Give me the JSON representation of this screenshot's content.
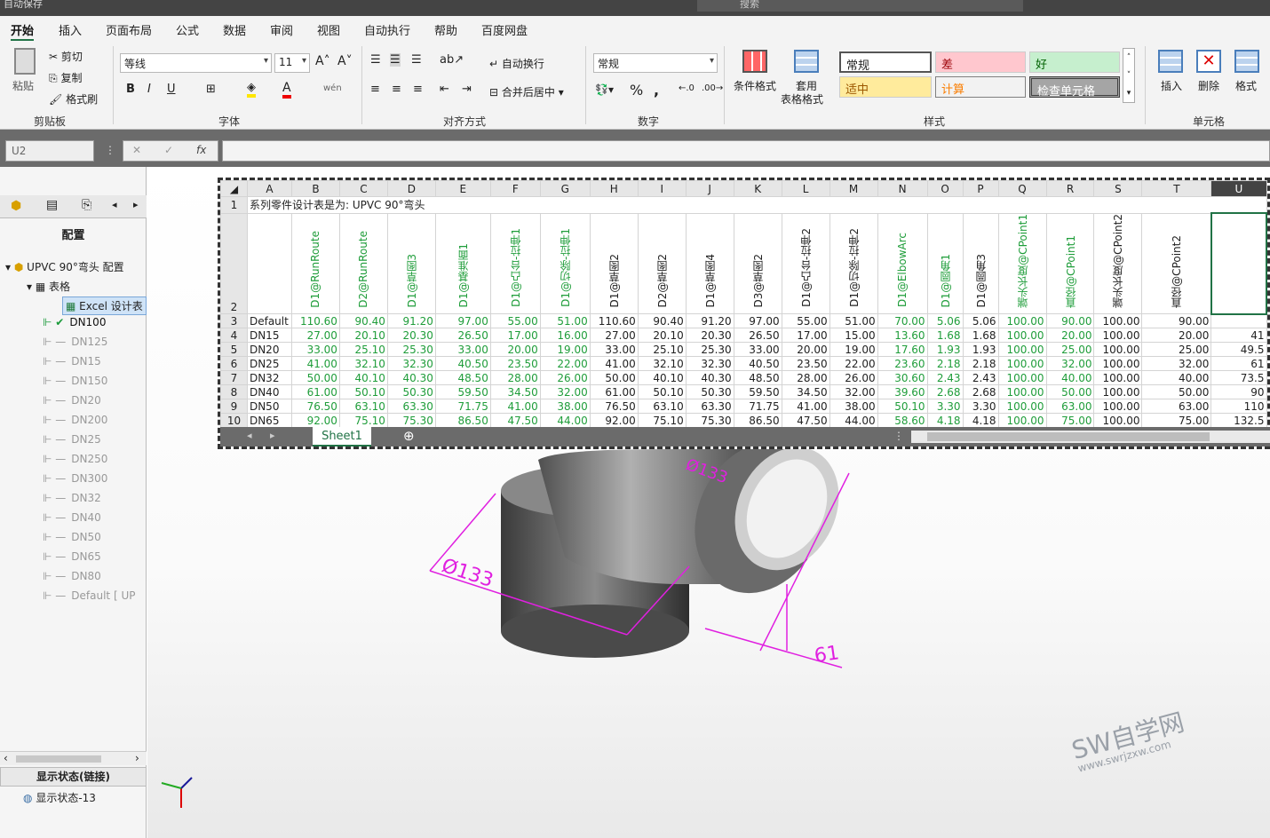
{
  "topbar": {
    "autosave": "自动保存",
    "search": "搜索"
  },
  "tabs": [
    "开始",
    "插入",
    "页面布局",
    "公式",
    "数据",
    "审阅",
    "视图",
    "自动执行",
    "帮助",
    "百度网盘"
  ],
  "ribbon": {
    "clipboard": {
      "paste": "粘贴",
      "cut": "剪切",
      "copy": "复制",
      "format_painter": "格式刷",
      "label": "剪贴板"
    },
    "font": {
      "name": "等线",
      "size": "11",
      "label": "字体"
    },
    "align": {
      "wrap": "自动换行",
      "merge": "合并后居中",
      "label": "对齐方式"
    },
    "number": {
      "format": "常规",
      "label": "数字"
    },
    "styles": {
      "cond": "条件格式",
      "table": "套用",
      "table2": "表格格式",
      "normal": "常规",
      "bad": "差",
      "good": "好",
      "neutral": "适中",
      "calc": "计算",
      "check": "检查单元格",
      "label": "样式"
    },
    "cells": {
      "insert": "插入",
      "delete": "删除",
      "format": "格式",
      "label": "单元格"
    }
  },
  "formula": {
    "namebox": "U2",
    "fx": "fx"
  },
  "left": {
    "title": "配置",
    "root": "UPVC 90°弯头 配置",
    "tables": "表格",
    "excel": "Excel 设计表",
    "configs": [
      "DN100",
      "DN125",
      "DN15",
      "DN150",
      "DN20",
      "DN200",
      "DN25",
      "DN250",
      "DN300",
      "DN32",
      "DN40",
      "DN50",
      "DN65",
      "DN80",
      "Default [ UP"
    ],
    "display_state_header": "显示状态(链接)",
    "display_state": "显示状态-13"
  },
  "sheet": {
    "cols": [
      "A",
      "B",
      "C",
      "D",
      "E",
      "F",
      "G",
      "H",
      "I",
      "J",
      "K",
      "L",
      "M",
      "N",
      "O",
      "P",
      "Q",
      "R",
      "S",
      "T",
      "U"
    ],
    "row1": "系列零件设计表是为:   UPVC 90°弯头",
    "headers": [
      "D1@RunRoute",
      "D2@RunRoute",
      "D1@草图3",
      "D1@基准面1",
      "D1@凸台-拉伸1",
      "D1@切除-拉伸1",
      "D1@草图2",
      "D2@草图2",
      "D1@草图4",
      "D3@草图2",
      "D1@凸台-拉伸2",
      "D1@切除-拉伸2",
      "D1@ElbowArc",
      "D1@圆角1",
      "D1@圆角3",
      "端头长度@CPoint1",
      "直径@CPoint1",
      "端头长度@CPoint2",
      "直径@CPoint2",
      ""
    ],
    "header_green": [
      true,
      true,
      true,
      true,
      true,
      true,
      false,
      false,
      false,
      false,
      false,
      false,
      true,
      true,
      false,
      true,
      true,
      false,
      false,
      false
    ],
    "rows": [
      [
        "Default",
        "110.60",
        "90.40",
        "91.20",
        "97.00",
        "55.00",
        "51.00",
        "110.60",
        "90.40",
        "91.20",
        "97.00",
        "55.00",
        "51.00",
        "70.00",
        "5.06",
        "5.06",
        "100.00",
        "90.00",
        "100.00",
        "90.00",
        ""
      ],
      [
        "DN15",
        "27.00",
        "20.10",
        "20.30",
        "26.50",
        "17.00",
        "16.00",
        "27.00",
        "20.10",
        "20.30",
        "26.50",
        "17.00",
        "15.00",
        "13.60",
        "1.68",
        "1.68",
        "100.00",
        "20.00",
        "100.00",
        "20.00",
        "41"
      ],
      [
        "DN20",
        "33.00",
        "25.10",
        "25.30",
        "33.00",
        "20.00",
        "19.00",
        "33.00",
        "25.10",
        "25.30",
        "33.00",
        "20.00",
        "19.00",
        "17.60",
        "1.93",
        "1.93",
        "100.00",
        "25.00",
        "100.00",
        "25.00",
        "49.5"
      ],
      [
        "DN25",
        "41.00",
        "32.10",
        "32.30",
        "40.50",
        "23.50",
        "22.00",
        "41.00",
        "32.10",
        "32.30",
        "40.50",
        "23.50",
        "22.00",
        "23.60",
        "2.18",
        "2.18",
        "100.00",
        "32.00",
        "100.00",
        "32.00",
        "61"
      ],
      [
        "DN32",
        "50.00",
        "40.10",
        "40.30",
        "48.50",
        "28.00",
        "26.00",
        "50.00",
        "40.10",
        "40.30",
        "48.50",
        "28.00",
        "26.00",
        "30.60",
        "2.43",
        "2.43",
        "100.00",
        "40.00",
        "100.00",
        "40.00",
        "73.5"
      ],
      [
        "DN40",
        "61.00",
        "50.10",
        "50.30",
        "59.50",
        "34.50",
        "32.00",
        "61.00",
        "50.10",
        "50.30",
        "59.50",
        "34.50",
        "32.00",
        "39.60",
        "2.68",
        "2.68",
        "100.00",
        "50.00",
        "100.00",
        "50.00",
        "90"
      ],
      [
        "DN50",
        "76.50",
        "63.10",
        "63.30",
        "71.75",
        "41.00",
        "38.00",
        "76.50",
        "63.10",
        "63.30",
        "71.75",
        "41.00",
        "38.00",
        "50.10",
        "3.30",
        "3.30",
        "100.00",
        "63.00",
        "100.00",
        "63.00",
        "110"
      ],
      [
        "DN65",
        "92.00",
        "75.10",
        "75.30",
        "86.50",
        "47.50",
        "44.00",
        "92.00",
        "75.10",
        "75.30",
        "86.50",
        "47.50",
        "44.00",
        "58.60",
        "4.18",
        "4.18",
        "100.00",
        "75.00",
        "100.00",
        "75.00",
        "132.5"
      ]
    ],
    "tab": "Sheet1"
  },
  "dims": [
    "Ø133",
    "Ø133",
    "61"
  ],
  "watermark": "SW自学网",
  "watermark_url": "www.swrjzxw.com"
}
